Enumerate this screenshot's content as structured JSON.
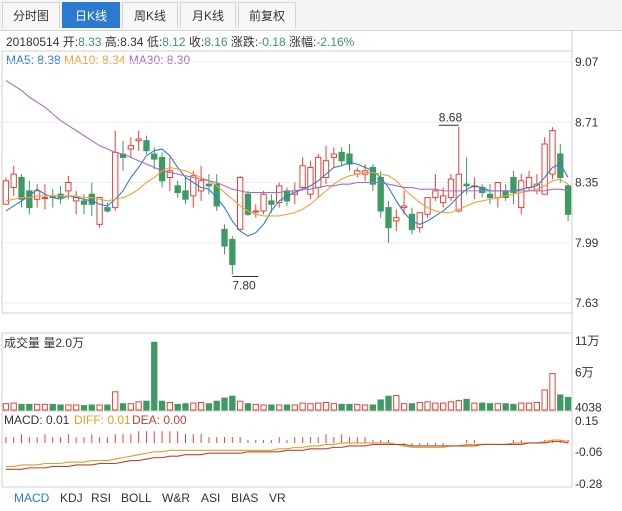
{
  "tabs": [
    {
      "label": "分时图",
      "active": false
    },
    {
      "label": "日K线",
      "active": true
    },
    {
      "label": "周K线",
      "active": false
    },
    {
      "label": "月K线",
      "active": false
    },
    {
      "label": "前复权",
      "active": false
    }
  ],
  "info": {
    "date": "20180514",
    "open_label": "开:",
    "open": "8.33",
    "high_label": "高:",
    "high": "8.34",
    "low_label": "低:",
    "low": "8.12",
    "close_label": "收:",
    "close": "8.16",
    "change_label": "涨跌:",
    "change": "-0.18",
    "pct_label": "涨幅:",
    "pct": "-2.16%"
  },
  "ma_legend": {
    "ma5": "MA5: 8.38",
    "ma10": "MA10: 8.34",
    "ma30": "MA30: 8.30"
  },
  "volume_panel": {
    "title": "成交量 量2.0万"
  },
  "macd_panel": {
    "macd": "MACD: 0.01",
    "diff": "DIFF: 0.01",
    "dea": "DEA: 0.00"
  },
  "indicator_tabs": [
    "MACD",
    "KDJ",
    "RSI",
    "BOLL",
    "W&R",
    "ASI",
    "BIAS",
    "VR"
  ],
  "colors": {
    "up": "#e8423a",
    "down": "#3c9a63",
    "ma5": "#2e7fd1",
    "ma10": "#f0a23a",
    "ma30": "#a86ec4",
    "active_tab": "#2b7ad0"
  },
  "chart_data": [
    {
      "type": "candlestick",
      "title": "日K线",
      "ylim": [
        7.63,
        9.07
      ],
      "y_ticks": [
        "9.07",
        "8.71",
        "8.35",
        "7.99",
        "7.63"
      ],
      "annotations": [
        {
          "label": "8.68",
          "value": 8.68
        },
        {
          "label": "7.80",
          "value": 7.8
        }
      ],
      "ohlc": [
        [
          8.22,
          8.38,
          8.24,
          8.36
        ],
        [
          8.32,
          8.45,
          8.27,
          8.4
        ],
        [
          8.38,
          8.4,
          8.2,
          8.25
        ],
        [
          8.3,
          8.36,
          8.16,
          8.2
        ],
        [
          8.25,
          8.34,
          8.2,
          8.3
        ],
        [
          8.26,
          8.34,
          8.19,
          8.26
        ],
        [
          8.27,
          8.31,
          8.2,
          8.26
        ],
        [
          8.28,
          8.33,
          8.22,
          8.26
        ],
        [
          8.3,
          8.39,
          8.25,
          8.35
        ],
        [
          8.24,
          8.3,
          8.16,
          8.26
        ],
        [
          8.24,
          8.28,
          8.16,
          8.22
        ],
        [
          8.28,
          8.35,
          8.15,
          8.22
        ],
        [
          8.1,
          8.26,
          8.08,
          8.26
        ],
        [
          8.2,
          8.23,
          8.17,
          8.18
        ],
        [
          8.2,
          8.66,
          8.18,
          8.53
        ],
        [
          8.52,
          8.6,
          8.42,
          8.5
        ],
        [
          8.55,
          8.62,
          8.5,
          8.57
        ],
        [
          8.6,
          8.66,
          8.54,
          8.61
        ],
        [
          8.6,
          8.63,
          8.52,
          8.54
        ],
        [
          8.52,
          8.56,
          8.43,
          8.49
        ],
        [
          8.5,
          8.53,
          8.32,
          8.36
        ],
        [
          8.38,
          8.5,
          8.3,
          8.42
        ],
        [
          8.33,
          8.36,
          8.26,
          8.29
        ],
        [
          8.3,
          8.38,
          8.22,
          8.25
        ],
        [
          8.27,
          8.42,
          8.2,
          8.39
        ],
        [
          8.3,
          8.45,
          8.24,
          8.36
        ],
        [
          8.34,
          8.4,
          8.28,
          8.33
        ],
        [
          8.34,
          8.4,
          8.18,
          8.21
        ],
        [
          8.07,
          8.1,
          7.92,
          7.97
        ],
        [
          8.01,
          8.03,
          7.8,
          7.86
        ],
        [
          8.07,
          8.39,
          8.06,
          8.38
        ],
        [
          8.28,
          8.3,
          8.15,
          8.16
        ],
        [
          8.18,
          8.22,
          8.14,
          8.18
        ],
        [
          8.18,
          8.3,
          8.16,
          8.28
        ],
        [
          8.24,
          8.28,
          8.17,
          8.22
        ],
        [
          8.23,
          8.35,
          8.2,
          8.33
        ],
        [
          8.3,
          8.32,
          8.21,
          8.24
        ],
        [
          8.28,
          8.35,
          8.22,
          8.3
        ],
        [
          8.32,
          8.5,
          8.3,
          8.45
        ],
        [
          8.28,
          8.48,
          8.25,
          8.44
        ],
        [
          8.32,
          8.52,
          8.26,
          8.5
        ],
        [
          8.38,
          8.57,
          8.34,
          8.48
        ],
        [
          8.5,
          8.56,
          8.44,
          8.52
        ],
        [
          8.53,
          8.56,
          8.45,
          8.48
        ],
        [
          8.52,
          8.58,
          8.42,
          8.46
        ],
        [
          8.4,
          8.44,
          8.38,
          8.42
        ],
        [
          8.4,
          8.46,
          8.36,
          8.42
        ],
        [
          8.44,
          8.46,
          8.3,
          8.34
        ],
        [
          8.38,
          8.42,
          8.14,
          8.18
        ],
        [
          8.2,
          8.24,
          7.99,
          8.08
        ],
        [
          8.12,
          8.19,
          8.06,
          8.14
        ],
        [
          8.2,
          8.3,
          8.16,
          8.21
        ],
        [
          8.16,
          8.2,
          8.04,
          8.07
        ],
        [
          8.08,
          8.17,
          8.05,
          8.17
        ],
        [
          8.16,
          8.26,
          8.14,
          8.26
        ],
        [
          8.26,
          8.4,
          8.24,
          8.3
        ],
        [
          8.23,
          8.32,
          8.2,
          8.27
        ],
        [
          8.26,
          8.4,
          8.24,
          8.37
        ],
        [
          8.18,
          8.68,
          8.17,
          8.4
        ],
        [
          8.34,
          8.5,
          8.28,
          8.33
        ],
        [
          8.33,
          8.38,
          8.25,
          8.33
        ],
        [
          8.32,
          8.34,
          8.26,
          8.29
        ],
        [
          8.28,
          8.34,
          8.22,
          8.26
        ],
        [
          8.26,
          8.35,
          8.2,
          8.35
        ],
        [
          8.3,
          8.34,
          8.24,
          8.26
        ],
        [
          8.38,
          8.42,
          8.22,
          8.29
        ],
        [
          8.2,
          8.4,
          8.16,
          8.36
        ],
        [
          8.32,
          8.42,
          8.3,
          8.38
        ],
        [
          8.3,
          8.4,
          8.28,
          8.34
        ],
        [
          8.28,
          8.62,
          8.28,
          8.58
        ],
        [
          8.4,
          8.68,
          8.37,
          8.66
        ],
        [
          8.52,
          8.58,
          8.35,
          8.38
        ],
        [
          8.33,
          8.34,
          8.12,
          8.16
        ]
      ],
      "series": [
        {
          "name": "MA5",
          "values": [
            8.18,
            8.21,
            8.24,
            8.27,
            8.31,
            8.28,
            8.26,
            8.25,
            8.27,
            8.26,
            8.25,
            8.24,
            8.22,
            8.21,
            8.25,
            8.3,
            8.38,
            8.44,
            8.51,
            8.54,
            8.55,
            8.51,
            8.44,
            8.38,
            8.35,
            8.32,
            8.31,
            8.26,
            8.2,
            8.12,
            8.06,
            8.03,
            8.05,
            8.1,
            8.18,
            8.24,
            8.27,
            8.29,
            8.31,
            8.33,
            8.36,
            8.4,
            8.44,
            8.45,
            8.47,
            8.46,
            8.44,
            8.42,
            8.38,
            8.32,
            8.24,
            8.17,
            8.12,
            8.1,
            8.12,
            8.15,
            8.18,
            8.22,
            8.27,
            8.31,
            8.33,
            8.32,
            8.3,
            8.3,
            8.3,
            8.3,
            8.31,
            8.32,
            8.33,
            8.38,
            8.44,
            8.46,
            8.38
          ]
        },
        {
          "name": "MA10",
          "values": [
            8.24,
            8.25,
            8.26,
            8.26,
            8.27,
            8.27,
            8.27,
            8.27,
            8.27,
            8.27,
            8.26,
            8.26,
            8.25,
            8.24,
            8.25,
            8.26,
            8.28,
            8.31,
            8.35,
            8.38,
            8.42,
            8.44,
            8.43,
            8.42,
            8.4,
            8.38,
            8.36,
            8.33,
            8.29,
            8.25,
            8.21,
            8.18,
            8.16,
            8.15,
            8.15,
            8.15,
            8.16,
            8.17,
            8.19,
            8.22,
            8.26,
            8.3,
            8.34,
            8.37,
            8.39,
            8.4,
            8.41,
            8.41,
            8.4,
            8.39,
            8.36,
            8.31,
            8.27,
            8.23,
            8.2,
            8.18,
            8.17,
            8.17,
            8.19,
            8.21,
            8.23,
            8.24,
            8.25,
            8.26,
            8.27,
            8.28,
            8.29,
            8.3,
            8.31,
            8.33,
            8.36,
            8.37,
            8.34
          ]
        },
        {
          "name": "MA30",
          "values": [
            8.96,
            8.93,
            8.9,
            8.86,
            8.83,
            8.8,
            8.76,
            8.72,
            8.69,
            8.66,
            8.63,
            8.6,
            8.57,
            8.55,
            8.53,
            8.52,
            8.5,
            8.48,
            8.46,
            8.44,
            8.42,
            8.41,
            8.4,
            8.39,
            8.38,
            8.37,
            8.36,
            8.35,
            8.33,
            8.31,
            8.3,
            8.29,
            8.29,
            8.29,
            8.29,
            8.29,
            8.3,
            8.3,
            8.31,
            8.31,
            8.32,
            8.33,
            8.33,
            8.34,
            8.34,
            8.35,
            8.35,
            8.35,
            8.35,
            8.34,
            8.33,
            8.32,
            8.32,
            8.31,
            8.31,
            8.31,
            8.3,
            8.3,
            8.3,
            8.3,
            8.3,
            8.3,
            8.3,
            8.3,
            8.3,
            8.3,
            8.3,
            8.3,
            8.3,
            8.3,
            8.31,
            8.31,
            8.3
          ]
        }
      ]
    },
    {
      "type": "bar",
      "title": "成交量 量2.0万",
      "ylim": [
        0,
        11
      ],
      "y_ticks": [
        "11万",
        "6万",
        "4038"
      ],
      "values": [
        1.0,
        1.1,
        0.9,
        0.9,
        0.9,
        0.9,
        0.9,
        0.8,
        0.8,
        0.8,
        0.7,
        0.8,
        0.8,
        0.8,
        2.9,
        1.0,
        1.0,
        1.3,
        1.4,
        10.8,
        1.4,
        1.2,
        0.9,
        1.0,
        1.1,
        1.2,
        1.0,
        1.4,
        1.9,
        2.2,
        1.4,
        1.0,
        0.9,
        0.8,
        0.8,
        0.8,
        0.8,
        0.8,
        1.1,
        1.0,
        1.1,
        1.2,
        1.0,
        0.9,
        0.9,
        0.9,
        0.8,
        0.8,
        1.6,
        2.2,
        2.3,
        1.0,
        1.0,
        1.2,
        1.3,
        1.1,
        1.1,
        1.3,
        1.5,
        1.7,
        1.1,
        1.1,
        1.0,
        1.0,
        1.0,
        0.9,
        1.1,
        1.1,
        1.2,
        3.2,
        5.8,
        2.4,
        2.0
      ]
    },
    {
      "type": "line",
      "title": "MACD",
      "ylim": [
        -0.28,
        0.15
      ],
      "y_ticks": [
        "0.15",
        "-0.06",
        "-0.28"
      ],
      "series": [
        {
          "name": "DIFF",
          "values": [
            -0.16,
            -0.16,
            -0.15,
            -0.15,
            -0.15,
            -0.14,
            -0.14,
            -0.14,
            -0.13,
            -0.13,
            -0.13,
            -0.12,
            -0.12,
            -0.12,
            -0.11,
            -0.1,
            -0.09,
            -0.08,
            -0.07,
            -0.06,
            -0.06,
            -0.05,
            -0.05,
            -0.05,
            -0.05,
            -0.05,
            -0.05,
            -0.05,
            -0.05,
            -0.05,
            -0.05,
            -0.05,
            -0.05,
            -0.05,
            -0.05,
            -0.04,
            -0.04,
            -0.03,
            -0.03,
            -0.02,
            -0.02,
            -0.01,
            -0.01,
            0.0,
            0.0,
            0.0,
            0.0,
            0.0,
            0.0,
            0.0,
            -0.01,
            -0.02,
            -0.03,
            -0.03,
            -0.03,
            -0.03,
            -0.03,
            -0.02,
            -0.02,
            -0.01,
            -0.01,
            -0.01,
            -0.01,
            -0.01,
            -0.01,
            0.0,
            0.0,
            0.0,
            0.0,
            0.01,
            0.02,
            0.02,
            0.01
          ]
        },
        {
          "name": "DEA",
          "values": [
            -0.18,
            -0.18,
            -0.18,
            -0.17,
            -0.17,
            -0.17,
            -0.16,
            -0.16,
            -0.16,
            -0.15,
            -0.15,
            -0.15,
            -0.14,
            -0.14,
            -0.14,
            -0.13,
            -0.12,
            -0.12,
            -0.11,
            -0.1,
            -0.1,
            -0.09,
            -0.09,
            -0.08,
            -0.08,
            -0.08,
            -0.07,
            -0.07,
            -0.07,
            -0.07,
            -0.07,
            -0.06,
            -0.06,
            -0.06,
            -0.06,
            -0.06,
            -0.05,
            -0.05,
            -0.05,
            -0.04,
            -0.04,
            -0.04,
            -0.03,
            -0.03,
            -0.02,
            -0.02,
            -0.02,
            -0.01,
            -0.01,
            -0.01,
            -0.01,
            -0.01,
            -0.02,
            -0.02,
            -0.02,
            -0.02,
            -0.02,
            -0.02,
            -0.02,
            -0.02,
            -0.02,
            -0.01,
            -0.01,
            -0.01,
            -0.01,
            -0.01,
            -0.01,
            0.0,
            0.0,
            0.0,
            0.01,
            0.01,
            0.0
          ]
        }
      ]
    }
  ]
}
